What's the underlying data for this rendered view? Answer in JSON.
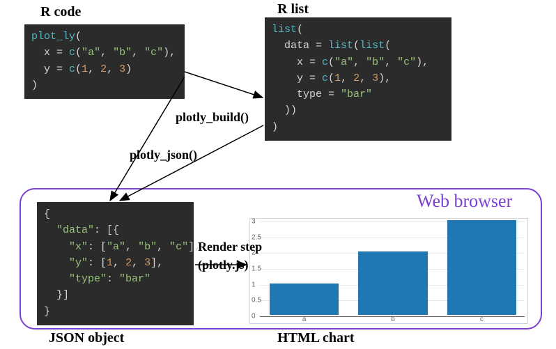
{
  "headings": {
    "rcode": "R code",
    "rlist": "R list",
    "json": "JSON object",
    "htmlchart": "HTML chart"
  },
  "arrows": {
    "build": "plotly_build()",
    "json": "plotly_json()",
    "render1": "Render step",
    "render2": "(plotly.js)"
  },
  "browser_label": "Web browser",
  "code": {
    "rcode": [
      {
        "segments": [
          [
            "fn",
            "plot_ly"
          ],
          [
            "punc",
            "("
          ]
        ]
      },
      {
        "segments": [
          [
            "id",
            "  x "
          ],
          [
            "punc",
            "= "
          ],
          [
            "fn",
            "c"
          ],
          [
            "punc",
            "("
          ],
          [
            "str",
            "\"a\""
          ],
          [
            "punc",
            ", "
          ],
          [
            "str",
            "\"b\""
          ],
          [
            "punc",
            ", "
          ],
          [
            "str",
            "\"c\""
          ],
          [
            "punc",
            "),"
          ]
        ]
      },
      {
        "segments": [
          [
            "id",
            "  y "
          ],
          [
            "punc",
            "= "
          ],
          [
            "fn",
            "c"
          ],
          [
            "punc",
            "("
          ],
          [
            "num",
            "1"
          ],
          [
            "punc",
            ", "
          ],
          [
            "num",
            "2"
          ],
          [
            "punc",
            ", "
          ],
          [
            "num",
            "3"
          ],
          [
            "punc",
            ")"
          ]
        ]
      },
      {
        "segments": [
          [
            "punc",
            ")"
          ]
        ]
      }
    ],
    "rlist": [
      {
        "segments": [
          [
            "fn",
            "list"
          ],
          [
            "punc",
            "("
          ]
        ]
      },
      {
        "segments": [
          [
            "id",
            "  data "
          ],
          [
            "punc",
            "= "
          ],
          [
            "fn",
            "list"
          ],
          [
            "punc",
            "("
          ],
          [
            "fn",
            "list"
          ],
          [
            "punc",
            "("
          ]
        ]
      },
      {
        "segments": [
          [
            "id",
            "    x "
          ],
          [
            "punc",
            "= "
          ],
          [
            "fn",
            "c"
          ],
          [
            "punc",
            "("
          ],
          [
            "str",
            "\"a\""
          ],
          [
            "punc",
            ", "
          ],
          [
            "str",
            "\"b\""
          ],
          [
            "punc",
            ", "
          ],
          [
            "str",
            "\"c\""
          ],
          [
            "punc",
            "),"
          ]
        ]
      },
      {
        "segments": [
          [
            "id",
            "    y "
          ],
          [
            "punc",
            "= "
          ],
          [
            "fn",
            "c"
          ],
          [
            "punc",
            "("
          ],
          [
            "num",
            "1"
          ],
          [
            "punc",
            ", "
          ],
          [
            "num",
            "2"
          ],
          [
            "punc",
            ", "
          ],
          [
            "num",
            "3"
          ],
          [
            "punc",
            "),"
          ]
        ]
      },
      {
        "segments": [
          [
            "id",
            "    type "
          ],
          [
            "punc",
            "= "
          ],
          [
            "str",
            "\"bar\""
          ]
        ]
      },
      {
        "segments": [
          [
            "punc",
            "  ))"
          ]
        ]
      },
      {
        "segments": [
          [
            "punc",
            ")"
          ]
        ]
      }
    ],
    "json": [
      {
        "segments": [
          [
            "punc",
            "{"
          ]
        ]
      },
      {
        "segments": [
          [
            "json-key",
            "  \"data\""
          ],
          [
            "punc",
            ": [{"
          ]
        ]
      },
      {
        "segments": [
          [
            "json-key",
            "    \"x\""
          ],
          [
            "punc",
            ": ["
          ],
          [
            "str",
            "\"a\""
          ],
          [
            "punc",
            ", "
          ],
          [
            "str",
            "\"b\""
          ],
          [
            "punc",
            ", "
          ],
          [
            "str",
            "\"c\""
          ],
          [
            "punc",
            "],"
          ]
        ]
      },
      {
        "segments": [
          [
            "json-key",
            "    \"y\""
          ],
          [
            "punc",
            ": ["
          ],
          [
            "num",
            "1"
          ],
          [
            "punc",
            ", "
          ],
          [
            "num",
            "2"
          ],
          [
            "punc",
            ", "
          ],
          [
            "num",
            "3"
          ],
          [
            "punc",
            "],"
          ]
        ]
      },
      {
        "segments": [
          [
            "json-key",
            "    \"type\""
          ],
          [
            "punc",
            ": "
          ],
          [
            "str",
            "\"bar\""
          ]
        ]
      },
      {
        "segments": [
          [
            "punc",
            "  }]"
          ]
        ]
      },
      {
        "segments": [
          [
            "punc",
            "}"
          ]
        ]
      }
    ]
  },
  "chart_data": {
    "type": "bar",
    "categories": [
      "a",
      "b",
      "c"
    ],
    "values": [
      1,
      2,
      3
    ],
    "title": "",
    "xlabel": "",
    "ylabel": "",
    "ylim": [
      0,
      3
    ],
    "yticks": [
      0,
      0.5,
      1,
      1.5,
      2,
      2.5,
      3
    ],
    "bar_color": "#1f77b4"
  }
}
